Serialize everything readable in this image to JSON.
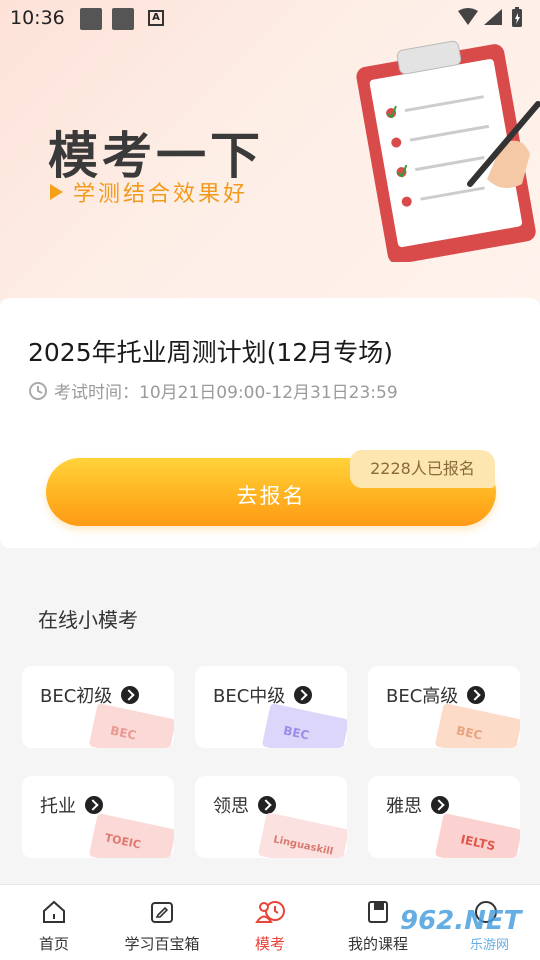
{
  "status_bar": {
    "time": "10:36",
    "icon_a": "A"
  },
  "hero": {
    "title": "模考一下",
    "subtitle": "学测结合效果好"
  },
  "exam": {
    "title": "2025年托业周测计划(12月专场)",
    "time_label": "考试时间：10月21日09:00-12月31日23:59",
    "button_label": "去报名",
    "signup_count": "2228人已报名"
  },
  "section": {
    "title": "在线小模考"
  },
  "tiles": [
    {
      "label": "BEC初级",
      "art": "BEC"
    },
    {
      "label": "BEC中级",
      "art": "BEC"
    },
    {
      "label": "BEC高级",
      "art": "BEC"
    },
    {
      "label": "托业",
      "art": "TOEIC"
    },
    {
      "label": "领思",
      "art": "Linguaskill"
    },
    {
      "label": "雅思",
      "art": "IELTS"
    }
  ],
  "tabs": [
    {
      "label": "首页",
      "icon": "home-icon"
    },
    {
      "label": "学习百宝箱",
      "icon": "toolbox-icon"
    },
    {
      "label": "模考",
      "icon": "exam-icon"
    },
    {
      "label": "我的课程",
      "icon": "course-icon"
    },
    {
      "label": "",
      "icon": "profile-icon"
    }
  ],
  "watermark": {
    "main": "962.NET",
    "sub": "乐游网"
  },
  "colors": {
    "accent": "#e8443a",
    "button": "#ffb01f",
    "subtitle": "#f39a1d"
  }
}
